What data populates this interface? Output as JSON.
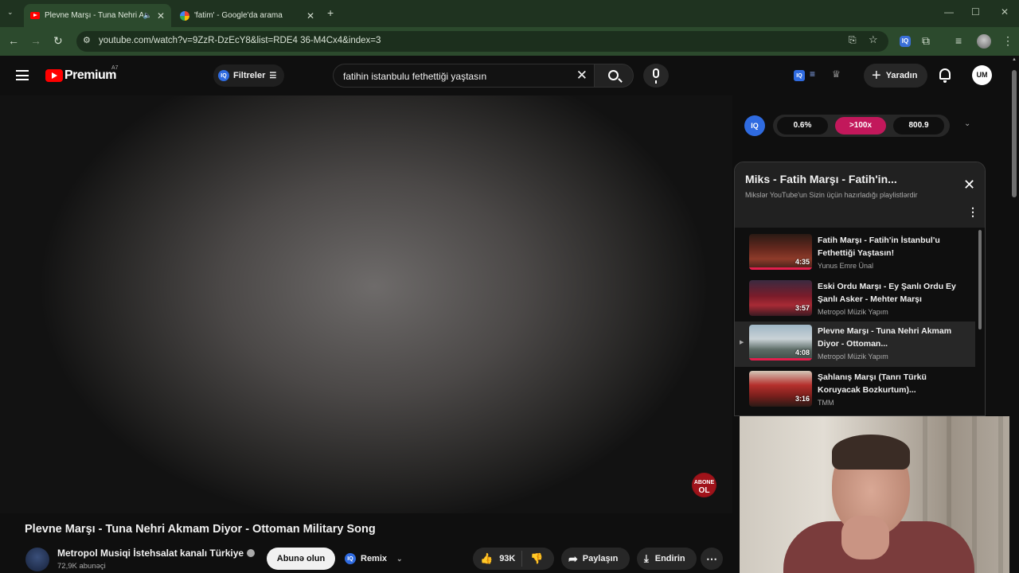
{
  "browser": {
    "tabs": [
      {
        "title": "Plevne Marşı - Tuna Nehri Akmam",
        "active": true
      },
      {
        "title": "'fatim' - Google'da arama",
        "active": false
      }
    ],
    "url": "youtube.com/watch?v=9ZzR-DzEcY8&list=RDE4 36-M4Cx4&index=3"
  },
  "header": {
    "brand": "Premium",
    "brand_sup": "A7",
    "filters_label": "Filtreler",
    "search_value": "fatihin istanbulu fethettiği yaştasın",
    "create_label": "Yaradın",
    "account_initials": "UM"
  },
  "player": {
    "abone_top": "ABONE",
    "abone_bottom": "OL"
  },
  "video": {
    "title": "Plevne Marşı - Tuna Nehri Akmam Diyor - Ottoman Military Song",
    "channel_name": "Metropol Musiqi İstehsalat kanalı Türkiye",
    "subscribers": "72,9K abunəçi",
    "subscribe_label": "Abunə olun",
    "remix_label": "Remix",
    "likes": "93K",
    "share_label": "Paylaşın",
    "download_label": "Endirin"
  },
  "iq_stats": {
    "logo": "IQ",
    "items": [
      "0.6%",
      ">100x",
      "800.9"
    ]
  },
  "playlist": {
    "title": "Miks - Fatih Marşı - Fatih'in...",
    "subtitle": "Mikslər YouTube'un Sizin üçün hazırladığı playlistlərdir",
    "items": [
      {
        "title": "Fatih Marşı - Fatih'in İstanbul'u Fethettiği Yaştasın!",
        "channel": "Yunus Emre Ünal",
        "duration": "4:35",
        "current": false
      },
      {
        "title": "Eski Ordu Marşı - Ey Şanlı Ordu Ey Şanlı Asker - Mehter Marşı",
        "channel": "Metropol Müzik Yapım",
        "duration": "3:57",
        "current": false
      },
      {
        "title": "Plevne Marşı - Tuna Nehri Akmam Diyor - Ottoman...",
        "channel": "Metropol Müzik Yapım",
        "duration": "4:08",
        "current": true
      },
      {
        "title": "Şahlanış Marşı (Tanrı Türkü Koruyacak Bozkurtum)...",
        "channel": "TMM",
        "duration": "3:16",
        "current": false
      }
    ]
  },
  "colors": {
    "accent_red": "#ff0000",
    "stat_highlight": "#c2185b",
    "progress_bar": "#e21f4d"
  }
}
